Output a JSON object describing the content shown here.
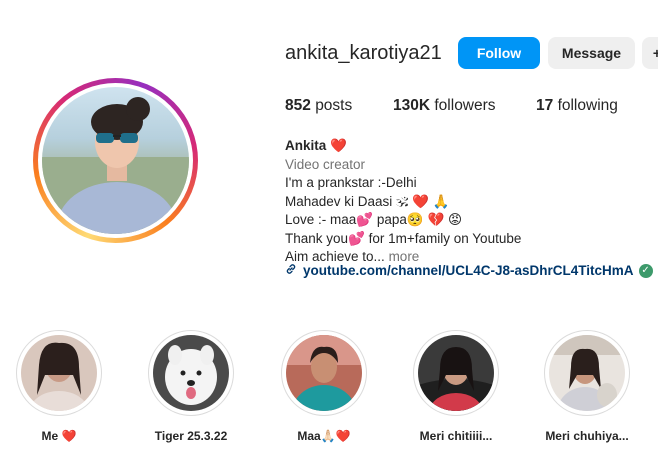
{
  "profile": {
    "username": "ankita_karotiya21",
    "follow_label": "Follow",
    "message_label": "Message",
    "more_label": "+"
  },
  "stats": {
    "posts_count": "852",
    "posts_label": "posts",
    "followers_count": "130K",
    "followers_label": "followers",
    "following_count": "17",
    "following_label": "following"
  },
  "bio": {
    "name": "Ankita",
    "name_emoji": "❤️",
    "category": "Video creator",
    "line1": "I'm a prankstar :-Delhi",
    "line2": "Mahadev ki Daasi",
    "line2_emoji": "🕉 ❤️ 🙏",
    "line3": "Love :- maa",
    "line3_mid": "papa",
    "line3_emoji_a": "💕",
    "line3_emoji_b": "🥺",
    "line3_emoji_c": "💔 😡",
    "line4_a": "Thank you",
    "line4_emoji": "💕",
    "line4_b": "for 1m+family on Youtube",
    "line5": "Aim achieve to...",
    "more_label": "more",
    "link": "youtube.com/channel/UCL4C-J8-asDhrCL4TitcHmA"
  },
  "highlights": [
    {
      "label": "Me ❤️"
    },
    {
      "label": "Tiger 25.3.22"
    },
    {
      "label": "Maa🙏🏻❤️"
    },
    {
      "label": "Meri chitiiii..."
    },
    {
      "label": "Meri chuhiya..."
    }
  ],
  "colors": {
    "follow_button": "#0095f6",
    "secondary_button": "#efefef",
    "link": "#00376b",
    "heart": "#ed1c24"
  }
}
